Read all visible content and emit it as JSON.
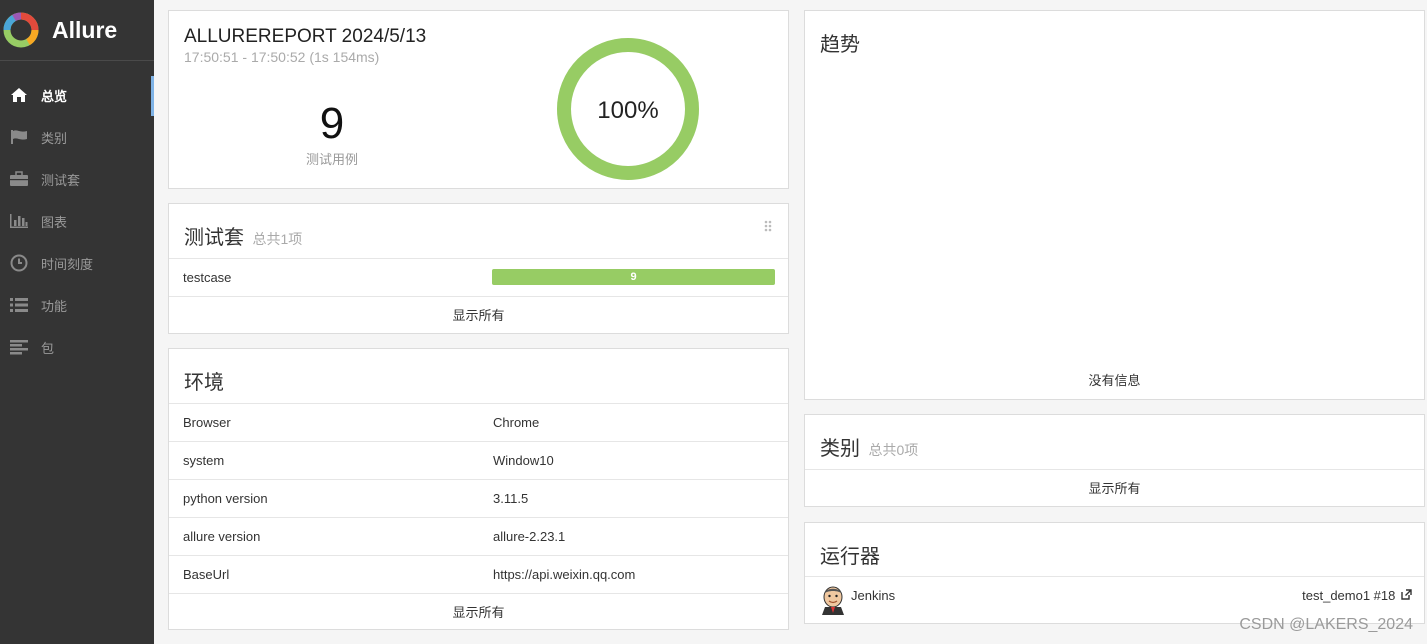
{
  "sidebar": {
    "brand": "Allure",
    "items": [
      {
        "label": "总览",
        "icon": "home-icon"
      },
      {
        "label": "类别",
        "icon": "flag-icon"
      },
      {
        "label": "测试套",
        "icon": "briefcase-icon"
      },
      {
        "label": "图表",
        "icon": "bar-chart-icon"
      },
      {
        "label": "时间刻度",
        "icon": "clock-icon"
      },
      {
        "label": "功能",
        "icon": "list-icon"
      },
      {
        "label": "包",
        "icon": "align-left-icon"
      }
    ],
    "active_index": 0
  },
  "summary": {
    "title": "ALLUREREPORT 2024/5/13",
    "time_range": "17:50:51 - 17:50:52 (1s 154ms)",
    "test_count": "9",
    "test_count_label": "测试用例",
    "pass_percent_text": "100%",
    "pass_fraction": 1.0,
    "ring_color": "#97cc64"
  },
  "suites": {
    "title": "测试套",
    "subtitle": "总共1项",
    "rows": [
      {
        "name": "testcase",
        "count": "9",
        "pass_fraction": 1.0
      }
    ],
    "show_all": "显示所有",
    "bar_color": "#97cc64"
  },
  "environment": {
    "title": "环境",
    "rows": [
      {
        "key": "Browser",
        "value": "Chrome"
      },
      {
        "key": "system",
        "value": "Window10"
      },
      {
        "key": "python version",
        "value": "3.11.5"
      },
      {
        "key": "allure version",
        "value": "allure-2.23.1"
      },
      {
        "key": "BaseUrl",
        "value": "https://api.weixin.qq.com"
      }
    ],
    "show_all": "显示所有"
  },
  "trend": {
    "title": "趋势",
    "empty_text": "没有信息"
  },
  "categories": {
    "title": "类别",
    "subtitle": "总共0项",
    "show_all": "显示所有"
  },
  "executors": {
    "title": "运行器",
    "name": "Jenkins",
    "build": "test_demo1 #18"
  },
  "watermark": "CSDN @LAKERS_2024"
}
